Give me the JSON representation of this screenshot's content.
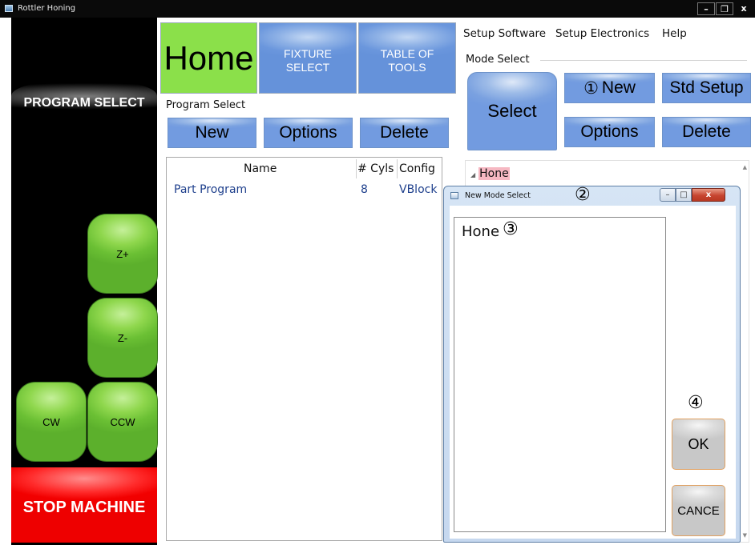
{
  "window": {
    "title": "Rottler Honing",
    "controls": {
      "minimize": "–",
      "maximize": "❐",
      "close": "x"
    }
  },
  "left_panel": {
    "program_select": "PROGRAM SELECT",
    "z_plus": "Z+",
    "z_minus": "Z-",
    "cw": "CW",
    "ccw": "CCW",
    "stop": "STOP MACHINE"
  },
  "tabs": {
    "home": "Home",
    "fixture_line1": "FIXTURE",
    "fixture_line2": "SELECT",
    "tools_line1": "TABLE OF",
    "tools_line2": "TOOLS"
  },
  "program_select": {
    "label": "Program Select",
    "buttons": {
      "new": "New",
      "options": "Options",
      "delete": "Delete"
    },
    "columns": {
      "name": "Name",
      "cyls": "# Cyls",
      "config": "Config"
    },
    "rows": [
      {
        "name": "Part Program",
        "cyls": "8",
        "config": "VBlock"
      }
    ]
  },
  "menu": {
    "setup_software": "Setup Software",
    "setup_electronics": "Setup Electronics",
    "help": "Help"
  },
  "mode_select": {
    "label": "Mode Select",
    "select": "Select",
    "new": "New",
    "std_setup": "Std Setup",
    "options": "Options",
    "delete": "Delete",
    "tree_root": "Hone",
    "tree_arrow": "◢"
  },
  "dialog": {
    "title": "New Mode Select",
    "controls": {
      "minimize": "–",
      "maximize": "□",
      "close": "x"
    },
    "text_value": "Hone",
    "ok": "OK",
    "cancel": "CANCE"
  },
  "annotations": {
    "a1": "①",
    "a2": "②",
    "a3": "③",
    "a4": "④"
  },
  "colors": {
    "green": "#8be04a",
    "blue_button": "#7aa1e0",
    "stop_red": "#f20000",
    "tree_highlight": "#f6b8c2",
    "link_text": "#1e3f8c"
  }
}
